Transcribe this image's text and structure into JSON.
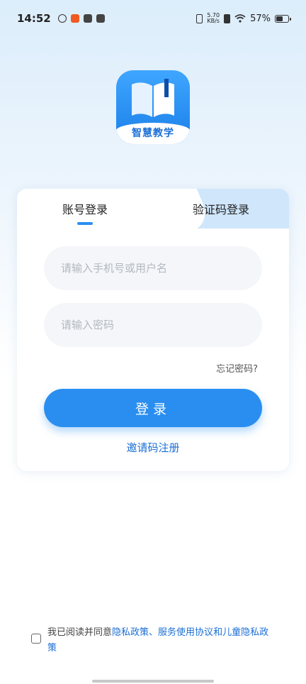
{
  "status_bar": {
    "time": "14:52",
    "net_speed_value": "5.70",
    "net_speed_unit": "KB/s",
    "battery_percent": "57%",
    "battery_level": 0.57
  },
  "logo": {
    "label": "智慧教学"
  },
  "tabs": {
    "account_login": "账号登录",
    "code_login": "验证码登录"
  },
  "form": {
    "username_placeholder": "请输入手机号或用户名",
    "username_value": "",
    "password_placeholder": "请输入密码",
    "password_value": "",
    "forgot_password": "忘记密码?",
    "login_button": "登录",
    "invite_register": "邀请码注册"
  },
  "agreement": {
    "prefix": "我已阅读并同意",
    "privacy_policy": "隐私政策",
    "separator": "、",
    "service_agreement": "服务使用协议",
    "and": "和",
    "child_privacy": "儿童隐私政策"
  },
  "colors": {
    "accent": "#2a8ef0",
    "link": "#1b6fd6"
  }
}
